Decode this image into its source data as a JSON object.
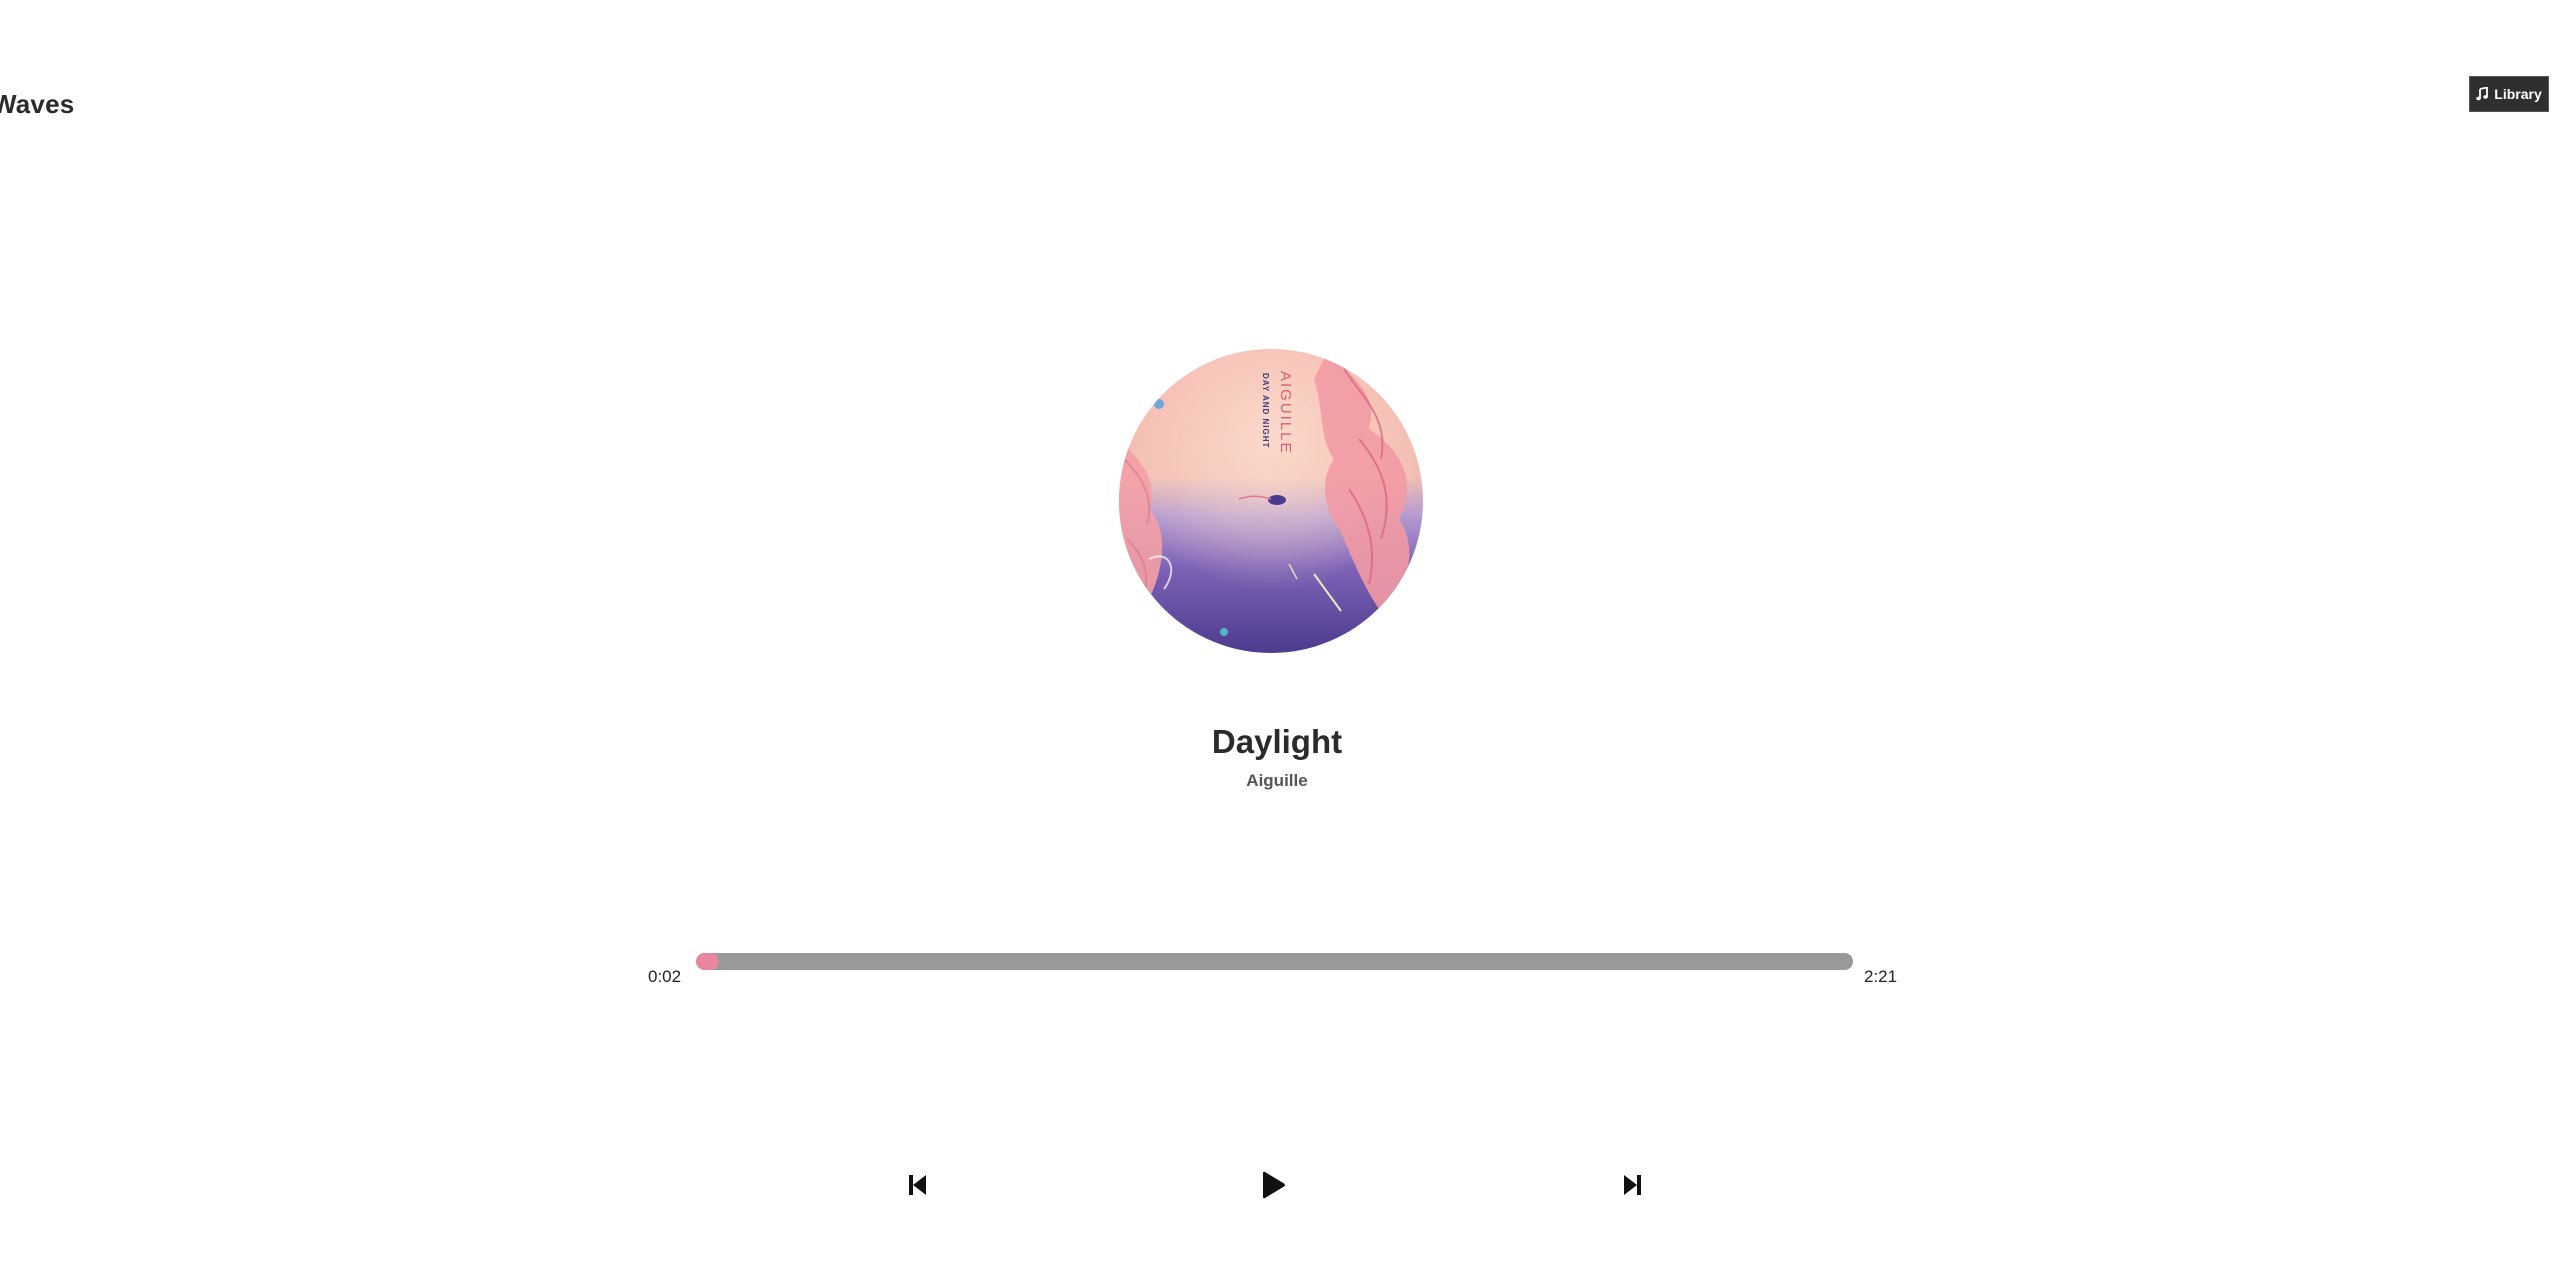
{
  "nav": {
    "title": "Waves",
    "library_label": "Library",
    "library_icon": "music-note-icon"
  },
  "song": {
    "title": "Daylight",
    "artist": "Aiguille",
    "cover_art_text": "AIGUILLE",
    "cover_art_subtext": "DAY AND NIGHT"
  },
  "player": {
    "current_time": "0:02",
    "total_time": "2:21",
    "progress_fraction": 0.02,
    "progress_color": "#e9869f",
    "track_color": "#999999",
    "controls": {
      "prev_icon": "skip-back-icon",
      "play_icon": "play-icon",
      "next_icon": "skip-forward-icon"
    }
  },
  "colors": {
    "nav_button_bg": "#2f2f2f",
    "text": "#2b2b2b"
  }
}
